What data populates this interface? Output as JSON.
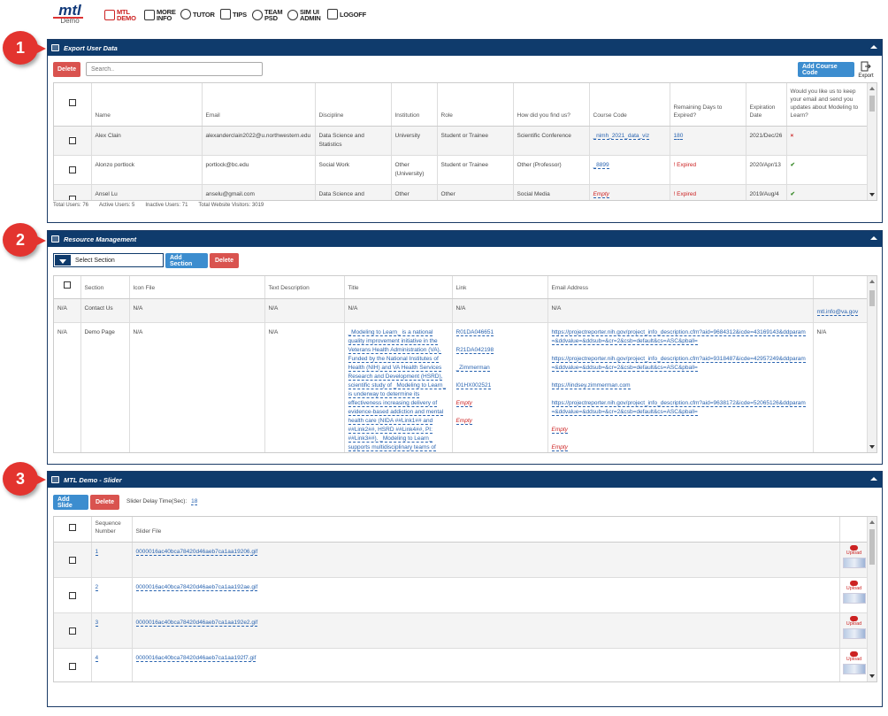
{
  "nav": {
    "logo": "mtl",
    "logo_sub": "Demo",
    "items": [
      {
        "l1": "MTL",
        "l2": "DEMO",
        "icon": "mtl-demo-icon",
        "active": true
      },
      {
        "l1": "MORE",
        "l2": "INFO",
        "icon": "book-icon"
      },
      {
        "l1": "TUTOR",
        "l2": "",
        "icon": "tutor-icon"
      },
      {
        "l1": "TIPS",
        "l2": "",
        "icon": "glasses-icon"
      },
      {
        "l1": "TEAM",
        "l2": "PSD",
        "icon": "gear-icon"
      },
      {
        "l1": "SIM UI",
        "l2": "ADMIN",
        "icon": "gear-icon"
      },
      {
        "l1": "LOGOFF",
        "l2": "",
        "icon": "logoff-icon"
      }
    ]
  },
  "callouts": [
    "1",
    "2",
    "3"
  ],
  "export_panel": {
    "title": "Export User Data",
    "delete": "Delete",
    "search_placeholder": "Search..",
    "add_course_code": "Add Course Code",
    "export": "Export",
    "headers": [
      "Name",
      "Email",
      "Discipline",
      "Institution",
      "Role",
      "How did you find us?",
      "Course Code",
      "Remaining Days to Expired?",
      "Expiration Date",
      "Would you like us to keep your email and send you updates about Modeling to Learn?"
    ],
    "rows": [
      {
        "name": "Alex Clain",
        "email": "alexanderclain2022@u.northwestern.edu",
        "discipline": "Data Science and Statistics",
        "institution": "University",
        "role": "Student or Trainee",
        "found": "Scientific Conference",
        "course": "_nimh_2021_data_viz",
        "remaining": "180",
        "expiration": "2021/Dec/26",
        "keep": "x"
      },
      {
        "name": "Alonzo portlock",
        "email": "portlock@bc.edu",
        "discipline": "Social Work",
        "institution": "Other (University)",
        "role": "Student or Trainee",
        "found": "Other (Professor)",
        "course": "_8899",
        "remaining": "! Expired",
        "expiration": "2020/Apr/13",
        "keep": "check"
      },
      {
        "name": "Ansel Lu",
        "email": "anselu@gmail.com",
        "discipline": "Data Science and Statistics",
        "institution": "Other",
        "role": "Other",
        "found": "Social Media",
        "course": "Empty",
        "remaining": "! Expired",
        "expiration": "2019/Aug/4",
        "keep": "check"
      }
    ],
    "footer": {
      "total": "Total Users: 76",
      "active": "Active Users: 5",
      "inactive": "Inactive Users: 71",
      "visitors": "Total Website Visitors: 3019"
    }
  },
  "resource_panel": {
    "title": "Resource Management",
    "select": "Select Section",
    "add_section": "Add Section",
    "delete": "Delete",
    "headers": [
      "Section",
      "Icon File",
      "Text Description",
      "Title",
      "Link",
      "Email Address"
    ],
    "rows": [
      {
        "na": "N/A",
        "section": "Contact Us",
        "icon": "N/A",
        "text": "N/A",
        "title": "N/A",
        "link": "N/A",
        "email": "N/A",
        "extra": "mtl.info@va.gov"
      },
      {
        "na": "N/A",
        "section": "Demo Page",
        "icon": "N/A",
        "text": "N/A",
        "title": "_Modeling to Learn_ is a national quality improvement initiative in the Veterans Health Administration (VA). Funded by the National Institutes of Health (NIH) and VA Health Services Research and Development (HSRD), scientific study of _Modeling to Learn_ is underway to determine its effectiveness increasing delivery of evidence-based addiction and mental health care (NIDA ##Link1## and ##Link2##, HSRD ##Link4##, PI: ##Link3##). _Modeling to Learn_ supports multidisciplinary teams of",
        "links": [
          "R01DA046651",
          "R21DA042198",
          "_Zimmerman",
          "I01HX002521",
          "Empty",
          "Empty"
        ],
        "emails": [
          "https://projectreporter.nih.gov/project_info_description.cfm?aid=9684312&icde=43169143&ddparam=&ddvalue=&ddsub=&cr=2&csb=default&cs=ASC&pball=",
          "https://projectreporter.nih.gov/project_info_description.cfm?aid=9318487&icde=42957249&ddparam=&ddvalue=&ddsub=&cr=2&csb=default&cs=ASC&pball=",
          "https://lindsey.zimmerman.com",
          "https://projectreporter.nih.gov/project_info_description.cfm?aid=9638172&icde=52065126&ddparam=&ddvalue=&ddsub=&cr=2&csb=default&cs=ASC&pball=",
          "Empty",
          "Empty"
        ],
        "extra": "N/A"
      }
    ]
  },
  "slider_panel": {
    "title": "MTL Demo - Slider",
    "add_slide": "Add Slide",
    "delete": "Delete",
    "delay_label": "Slider Delay Time(Sec):",
    "delay_value": "18",
    "headers": [
      "Sequence Number",
      "Slider File"
    ],
    "rows": [
      {
        "seq": "1",
        "file": "0000016ac40bca78420d46aeb7ca1aa19206.gif"
      },
      {
        "seq": "2",
        "file": "0000016ac40bca78420d46aeb7ca1aa192ae.gif"
      },
      {
        "seq": "3",
        "file": "0000016ac40bca78420d46aeb7ca1aa192e2.gif"
      },
      {
        "seq": "4",
        "file": "0000016ac40bca78420d46aeb7ca1aa192f7.gif"
      }
    ],
    "upload": "Upload"
  }
}
